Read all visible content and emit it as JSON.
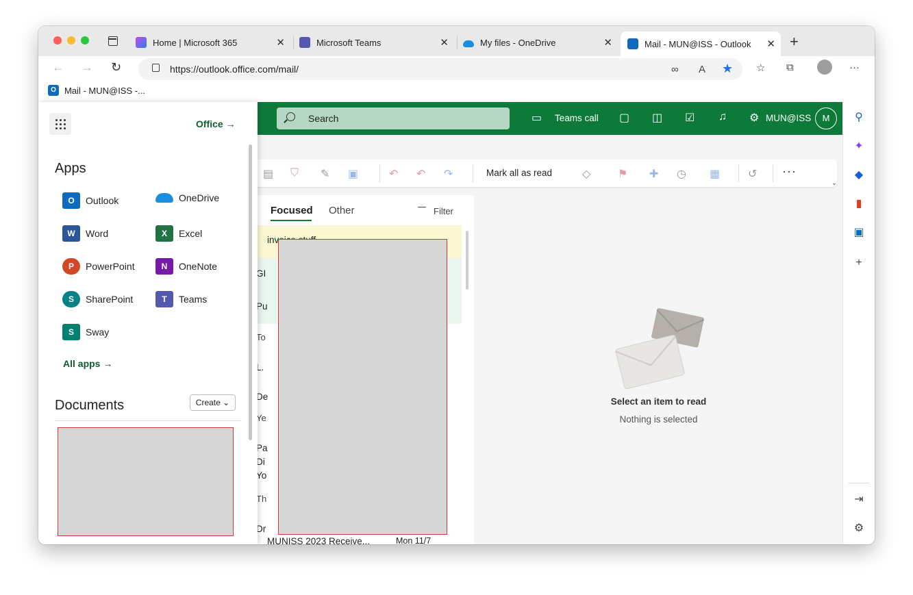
{
  "browser": {
    "tabs": [
      {
        "label": "Home | Microsoft 365",
        "close": "✕"
      },
      {
        "label": "Microsoft Teams",
        "close": "✕"
      },
      {
        "label": "My files - OneDrive",
        "close": "✕"
      },
      {
        "label": "Mail - MUN@ISS - Outlook",
        "close": "✕",
        "active": true
      }
    ],
    "new_tab": "+",
    "url": "https://outlook.office.com/mail/",
    "bookmark": "Mail - MUN@ISS -..."
  },
  "header": {
    "search_label": "Search",
    "teams_call": "Teams call",
    "account_label": "MUN@ISS",
    "avatar_initial": "M"
  },
  "ribbon": {
    "mark_all_read": "Mark all as read",
    "more": "···"
  },
  "maillist": {
    "focused": "Focused",
    "other": "Other",
    "filter": "Filter",
    "rows": [
      {
        "text": "invoice stuff"
      },
      {
        "text": "GI"
      },
      {
        "text": "Pu"
      }
    ],
    "groups": [
      {
        "label": "To"
      },
      {
        "label": "Ye"
      },
      {
        "label": "Th"
      }
    ],
    "row_snippets": [
      "L.",
      "De",
      "Pa",
      "Di",
      "Yo",
      "Dr"
    ],
    "last_subject": "MUNISS 2023 Receive...",
    "last_date": "Mon 11/7"
  },
  "reading_pane": {
    "title": "Select an item to read",
    "subtitle": "Nothing is selected"
  },
  "launcher": {
    "office_link": "Office →",
    "apps_title": "Apps",
    "apps": [
      {
        "name": "Outlook",
        "letter": "O",
        "color": "#0f6cbd"
      },
      {
        "name": "OneDrive",
        "letter": "",
        "color": "#1a8fe0"
      },
      {
        "name": "Word",
        "letter": "W",
        "color": "#2b579a"
      },
      {
        "name": "Excel",
        "letter": "X",
        "color": "#217346"
      },
      {
        "name": "PowerPoint",
        "letter": "P",
        "color": "#d24726"
      },
      {
        "name": "OneNote",
        "letter": "N",
        "color": "#7719aa"
      },
      {
        "name": "SharePoint",
        "letter": "S",
        "color": "#038387"
      },
      {
        "name": "Teams",
        "letter": "T",
        "color": "#5558af"
      },
      {
        "name": "Sway",
        "letter": "S",
        "color": "#008272"
      }
    ],
    "all_apps": "All apps →",
    "documents_title": "Documents",
    "create_label": "Create ⌄"
  },
  "colors": {
    "header_green": "#0e7a3a",
    "accent_link": "#0e5c2f"
  }
}
